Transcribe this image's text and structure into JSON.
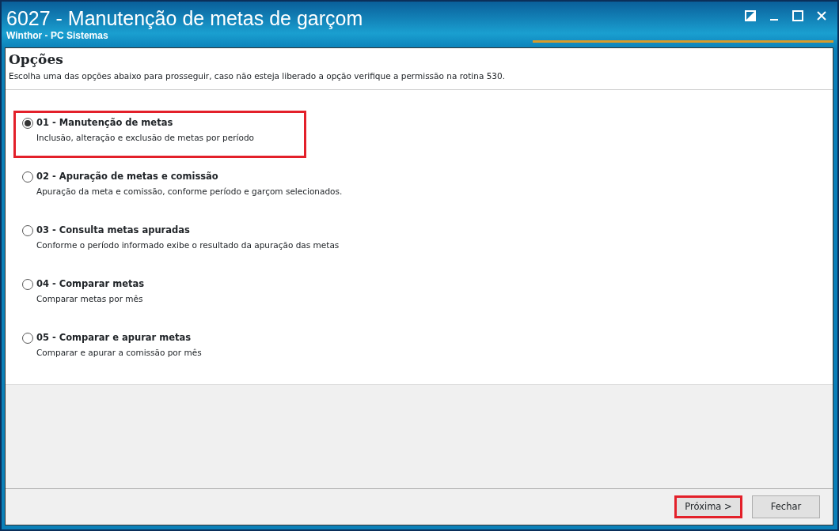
{
  "window": {
    "title": "6027 - Manutenção de metas de garçom",
    "subtitle": "Winthor - PC Sistemas"
  },
  "header": {
    "title": "Opções",
    "description": "Escolha uma das opções abaixo para prosseguir, caso não esteja liberado a opção verifique a permissão na rotina 530."
  },
  "options": [
    {
      "label": "01 - Manutenção de metas",
      "description": "Inclusão, alteração e exclusão de metas por período",
      "selected": true,
      "highlighted": true
    },
    {
      "label": "02 - Apuração de metas e comissão",
      "description": "Apuração da meta e comissão, conforme período e garçom selecionados.",
      "selected": false,
      "highlighted": false
    },
    {
      "label": "03 - Consulta metas apuradas",
      "description": "Conforme o período informado exibe o resultado da apuração das metas",
      "selected": false,
      "highlighted": false
    },
    {
      "label": "04 - Comparar metas",
      "description": "Comparar metas por mês",
      "selected": false,
      "highlighted": false
    },
    {
      "label": "05 - Comparar e apurar metas",
      "description": "Comparar e apurar a comissão por mês",
      "selected": false,
      "highlighted": false
    }
  ],
  "buttons": [
    {
      "label": "Próxima >",
      "highlighted": true
    },
    {
      "label": "Fechar",
      "highlighted": false
    }
  ]
}
